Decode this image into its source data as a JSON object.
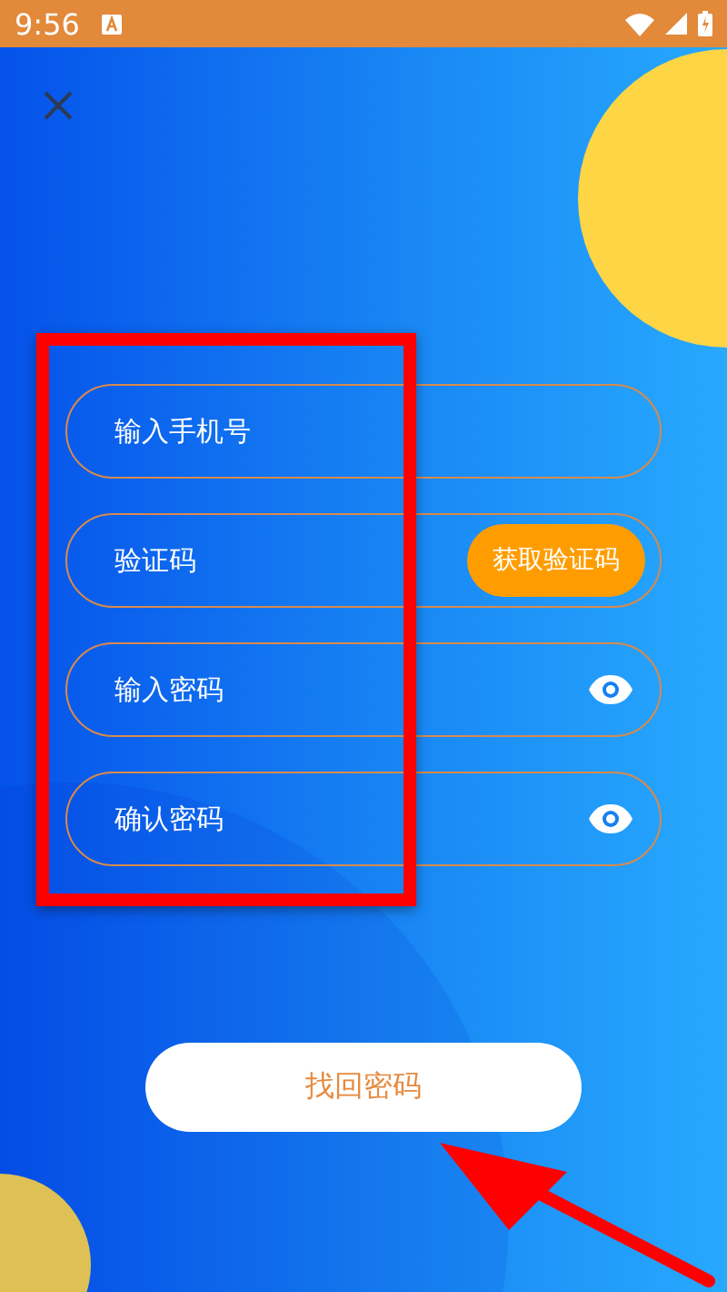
{
  "status_bar": {
    "time": "9:56"
  },
  "fields": [
    {
      "kind": "text",
      "placeholder": "输入手机号"
    },
    {
      "kind": "code",
      "placeholder": "验证码",
      "button": "获取验证码"
    },
    {
      "kind": "password",
      "placeholder": "输入密码"
    },
    {
      "kind": "password",
      "placeholder": "确认密码"
    }
  ],
  "submit_button": "找回密码"
}
